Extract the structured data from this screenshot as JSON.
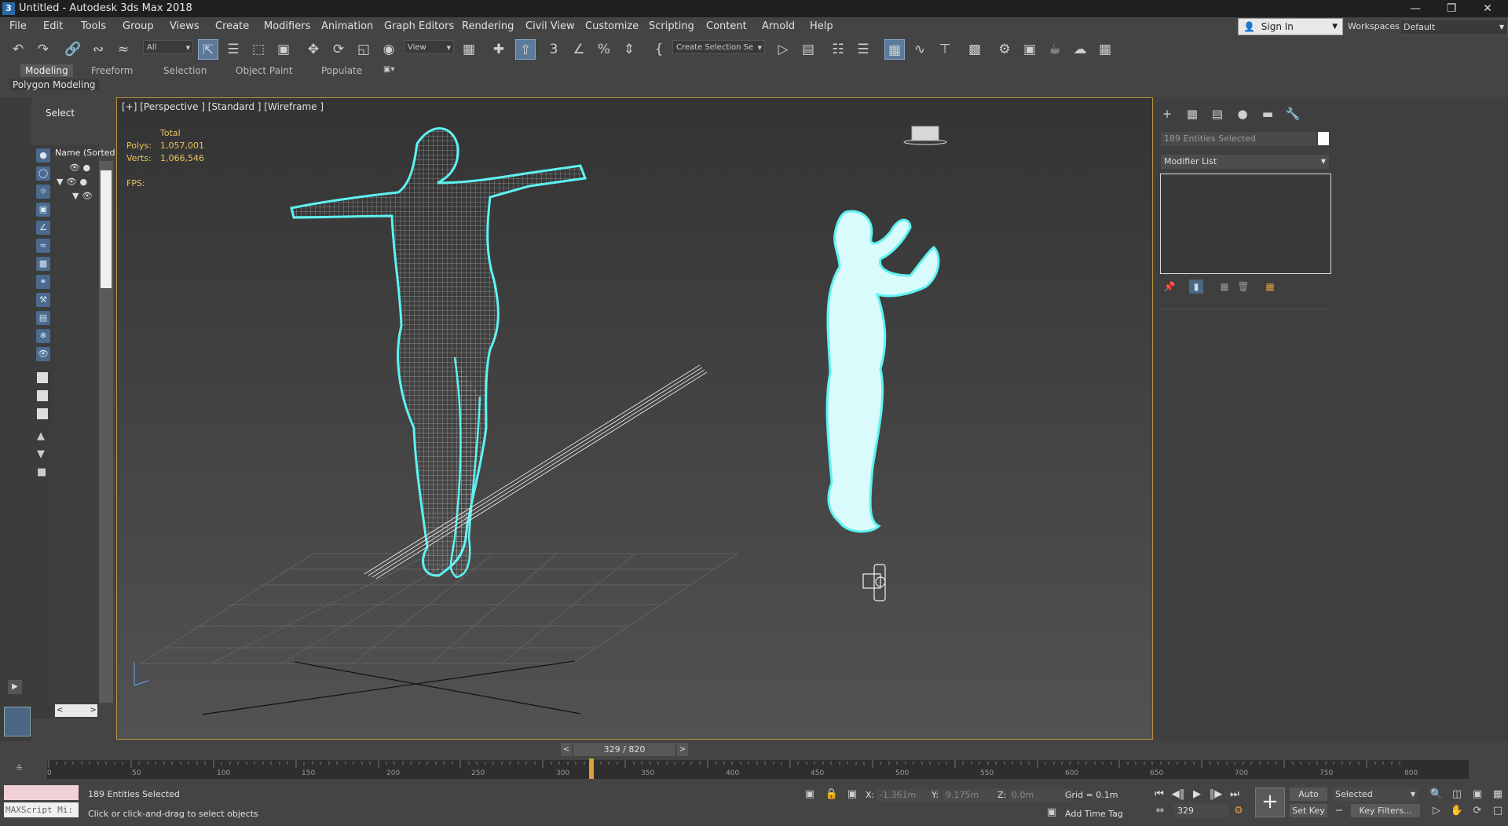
{
  "window": {
    "app_icon": "3",
    "title": "Untitled - Autodesk 3ds Max 2018",
    "controls": [
      "minimize-icon",
      "restore-icon",
      "close-icon"
    ]
  },
  "menu": [
    "File",
    "Edit",
    "Tools",
    "Group",
    "Views",
    "Create",
    "Modifiers",
    "Animation",
    "Graph Editors",
    "Rendering",
    "Civil View",
    "Customize",
    "Scripting",
    "Content",
    "Arnold",
    "Help"
  ],
  "account": {
    "sign_in": "Sign In",
    "workspaces_label": "Workspaces:",
    "workspace": "Default"
  },
  "toolbar": {
    "filter": "All",
    "ref_coord": "View",
    "selection_set": "Create Selection Se"
  },
  "ribbon": {
    "tabs": [
      "Modeling",
      "Freeform",
      "Selection",
      "Object Paint",
      "Populate"
    ],
    "active_tab": "Modeling",
    "panel": "Polygon Modeling"
  },
  "scene_explorer": {
    "header": "Select",
    "column": "Name (Sorted A"
  },
  "viewport": {
    "label": "[+] [Perspective ] [Standard ] [Wireframe ]",
    "stats": {
      "total_label": "Total",
      "polys_label": "Polys:",
      "polys": "1,057,001",
      "verts_label": "Verts:",
      "verts": "1,066,546",
      "fps_label": "FPS:"
    }
  },
  "command_panel": {
    "selection": "189 Entities Selected",
    "modifier_list": "Modifier List"
  },
  "timeline": {
    "frame_display": "329 / 820",
    "current_frame": 329,
    "total_frames": 820,
    "ticks": [
      "0",
      "50",
      "100",
      "150",
      "200",
      "250",
      "300",
      "350",
      "400",
      "450",
      "500",
      "550",
      "600",
      "650",
      "700",
      "750",
      "800"
    ]
  },
  "status": {
    "maxscript_label": "MAXScript Mi:",
    "selection": "189 Entities Selected",
    "prompt": "Click or click-and-drag to select objects",
    "x_label": "X:",
    "x": "-1.361m",
    "y_label": "Y:",
    "y": "9.175m",
    "z_label": "Z:",
    "z": "0.0m",
    "grid": "Grid = 0.1m",
    "add_time_tag": "Add Time Tag",
    "frame": "329",
    "auto_key": "Auto Key",
    "set_key": "Set Key",
    "key_mode": "Selected",
    "key_filters": "Key Filters..."
  }
}
